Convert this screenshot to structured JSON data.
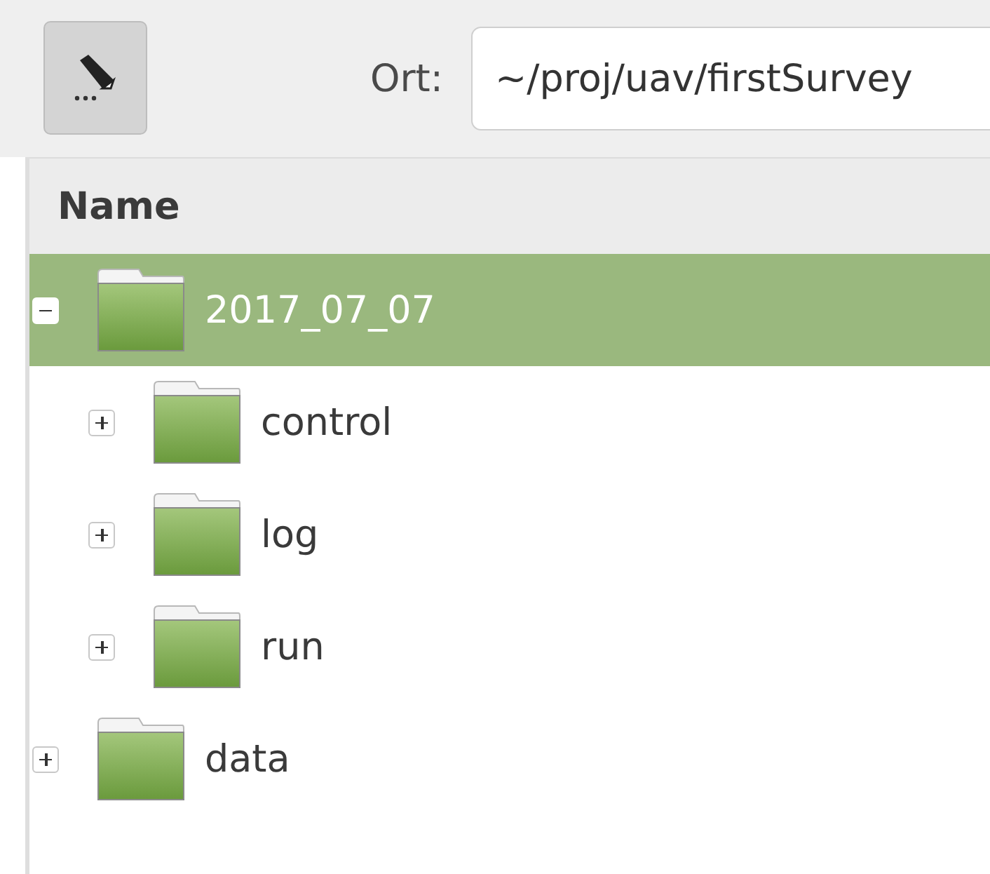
{
  "toolbar": {
    "edit_button": {
      "pressed": true
    },
    "location": {
      "label": "Ort:",
      "value": "~/proj/uav/firstSurvey"
    }
  },
  "file_list": {
    "columns": [
      "Name"
    ],
    "items": [
      {
        "name": "2017_07_07",
        "expanded": true,
        "selected": true,
        "children": [
          {
            "name": "control",
            "expanded": false,
            "selected": false
          },
          {
            "name": "log",
            "expanded": false,
            "selected": false
          },
          {
            "name": "run",
            "expanded": false,
            "selected": false
          }
        ]
      },
      {
        "name": "data",
        "expanded": false,
        "selected": false
      }
    ]
  }
}
